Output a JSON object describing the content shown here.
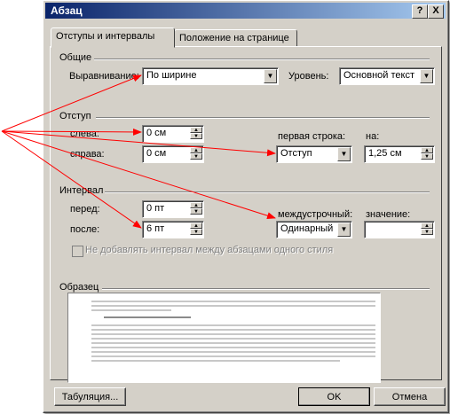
{
  "window": {
    "title": "Абзац",
    "help_label": "?",
    "close_label": "X"
  },
  "tabs": [
    {
      "label": "Отступы и интервалы"
    },
    {
      "label": "Положение на странице"
    }
  ],
  "general": {
    "section_label": "Общие",
    "alignment_label": "Выравнивание:",
    "alignment_value": "По ширине",
    "level_label": "Уровень:",
    "level_value": "Основной текст"
  },
  "indent": {
    "section_label": "Отступ",
    "left_label": "слева:",
    "left_value": "0 см",
    "right_label": "справа:",
    "right_value": "0 см",
    "first_line_label": "первая строка:",
    "first_line_value": "Отступ",
    "by_label": "на:",
    "by_value": "1,25 см"
  },
  "spacing": {
    "section_label": "Интервал",
    "before_label": "перед:",
    "before_value": "0 пт",
    "after_label": "после:",
    "after_value": "6 пт",
    "line_spacing_label": "междустрочный:",
    "line_spacing_value": "Одинарный",
    "at_label": "значение:",
    "at_value": "",
    "no_space_label": "Не добавлять интервал между абзацами одного стиля"
  },
  "preview": {
    "section_label": "Образец"
  },
  "buttons": {
    "tabs_label": "Табуляция...",
    "ok_label": "OK",
    "cancel_label": "Отмена"
  },
  "annotation_color": "#ff0000"
}
